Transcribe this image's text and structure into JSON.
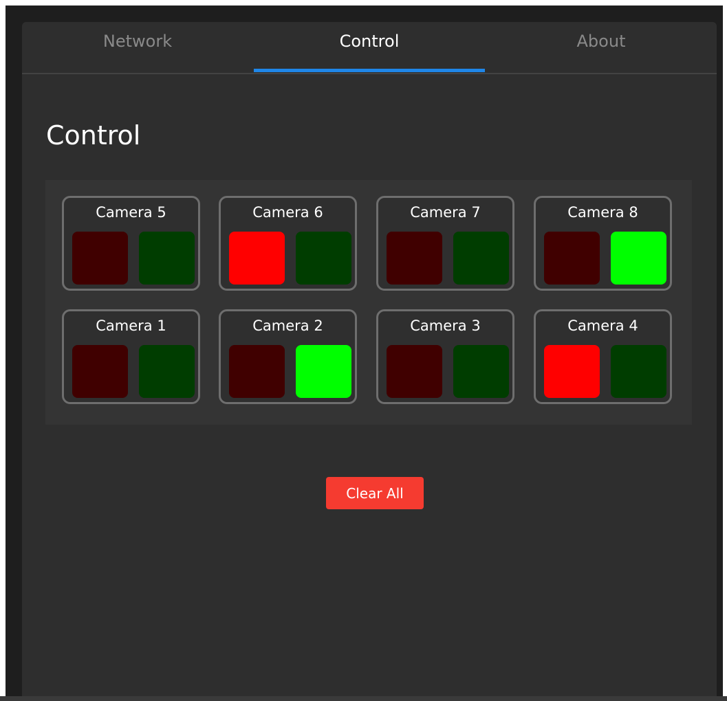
{
  "colors": {
    "accent": "#1f86e8",
    "tally_red_on": "#ff0000",
    "tally_red_off": "#400000",
    "tally_green_on": "#00ff00",
    "tally_green_off": "#003d00",
    "clear_button": "#f53b30"
  },
  "tabs": [
    {
      "label": "Network",
      "active": false
    },
    {
      "label": "Control",
      "active": true
    },
    {
      "label": "About",
      "active": false
    }
  ],
  "page": {
    "title": "Control"
  },
  "cameras": [
    {
      "name": "Camera 5",
      "red": false,
      "green": false
    },
    {
      "name": "Camera 6",
      "red": true,
      "green": false
    },
    {
      "name": "Camera 7",
      "red": false,
      "green": false
    },
    {
      "name": "Camera 8",
      "red": false,
      "green": true
    },
    {
      "name": "Camera 1",
      "red": false,
      "green": false
    },
    {
      "name": "Camera 2",
      "red": false,
      "green": true
    },
    {
      "name": "Camera 3",
      "red": false,
      "green": false
    },
    {
      "name": "Camera 4",
      "red": true,
      "green": false
    }
  ],
  "actions": {
    "clear_all_label": "Clear All"
  }
}
